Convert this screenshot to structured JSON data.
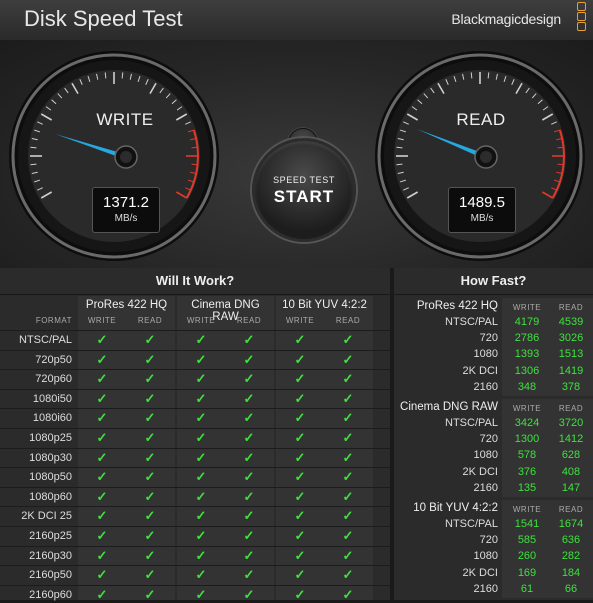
{
  "app": {
    "title": "Disk Speed Test",
    "brand": "Blackmagicdesign"
  },
  "write_gauge": {
    "label": "WRITE",
    "value": "1371.2",
    "unit": "MB/s"
  },
  "read_gauge": {
    "label": "READ",
    "value": "1489.5",
    "unit": "MB/s"
  },
  "start_button": {
    "line1": "SPEED TEST",
    "line2": "START"
  },
  "settings_icon": "gear-icon",
  "will_it_work": {
    "title": "Will It Work?",
    "format_header": "FORMAT",
    "groups": [
      {
        "name": "ProRes 422 HQ",
        "write": "WRITE",
        "read": "READ"
      },
      {
        "name": "Cinema DNG RAW",
        "write": "WRITE",
        "read": "READ"
      },
      {
        "name": "10 Bit YUV 4:2:2",
        "write": "WRITE",
        "read": "READ"
      }
    ],
    "formats": [
      "NTSC/PAL",
      "720p50",
      "720p60",
      "1080i50",
      "1080i60",
      "1080p25",
      "1080p30",
      "1080p50",
      "1080p60",
      "2K DCI 25",
      "2160p25",
      "2160p30",
      "2160p50",
      "2160p60"
    ],
    "check_glyph": "✓",
    "check_color": "#3fe03f"
  },
  "how_fast": {
    "title": "How Fast?",
    "groups": [
      {
        "name": "ProRes 422 HQ",
        "write": "WRITE",
        "read": "READ",
        "rows": [
          [
            "NTSC/PAL",
            "4179",
            "4539"
          ],
          [
            "720",
            "2786",
            "3026"
          ],
          [
            "1080",
            "1393",
            "1513"
          ],
          [
            "2K DCI",
            "1306",
            "1419"
          ],
          [
            "2160",
            "348",
            "378"
          ]
        ]
      },
      {
        "name": "Cinema DNG RAW",
        "write": "WRITE",
        "read": "READ",
        "rows": [
          [
            "NTSC/PAL",
            "3424",
            "3720"
          ],
          [
            "720",
            "1300",
            "1412"
          ],
          [
            "1080",
            "578",
            "628"
          ],
          [
            "2K DCI",
            "376",
            "408"
          ],
          [
            "2160",
            "135",
            "147"
          ]
        ]
      },
      {
        "name": "10 Bit YUV 4:2:2",
        "write": "WRITE",
        "read": "READ",
        "rows": [
          [
            "NTSC/PAL",
            "1541",
            "1674"
          ],
          [
            "720",
            "585",
            "636"
          ],
          [
            "1080",
            "260",
            "282"
          ],
          [
            "2K DCI",
            "169",
            "184"
          ],
          [
            "2160",
            "61",
            "66"
          ]
        ]
      }
    ]
  },
  "colors": {
    "needle": "#27a7e0",
    "check": "#3fe03f",
    "red_zone": "#e03a2a",
    "brand_accent": "#e8a033"
  }
}
